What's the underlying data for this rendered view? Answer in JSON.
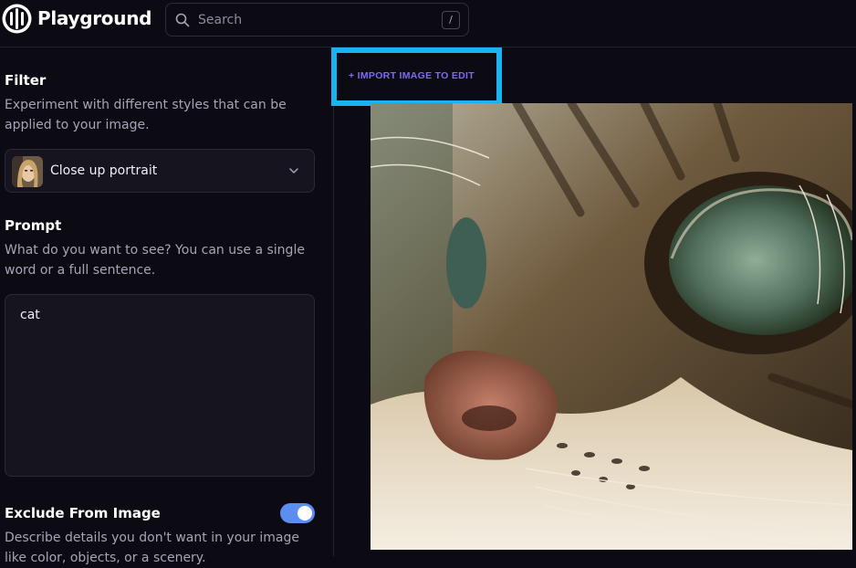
{
  "header": {
    "app_name": "Playground",
    "logo_icon": "playground-logo-icon",
    "search": {
      "placeholder": "Search",
      "shortcut": "/"
    }
  },
  "sidebar": {
    "filter": {
      "title": "Filter",
      "description": "Experiment with different styles that can be applied to your image.",
      "selected": "Close up portrait"
    },
    "prompt": {
      "title": "Prompt",
      "description": "What do you want to see? You can use a single word or a full sentence.",
      "value": "cat"
    },
    "exclude": {
      "title": "Exclude From Image",
      "enabled": true,
      "description": "Describe details you don't want in your image like color, objects, or a scenery."
    }
  },
  "main": {
    "import_button": "+ IMPORT IMAGE TO EDIT",
    "generated_image": "close-up cat face"
  },
  "colors": {
    "background": "#0c0b14",
    "accent_purple": "#7c6cf2",
    "highlight_cyan": "#1ab3ef",
    "toggle_blue": "#5b8ef0"
  }
}
